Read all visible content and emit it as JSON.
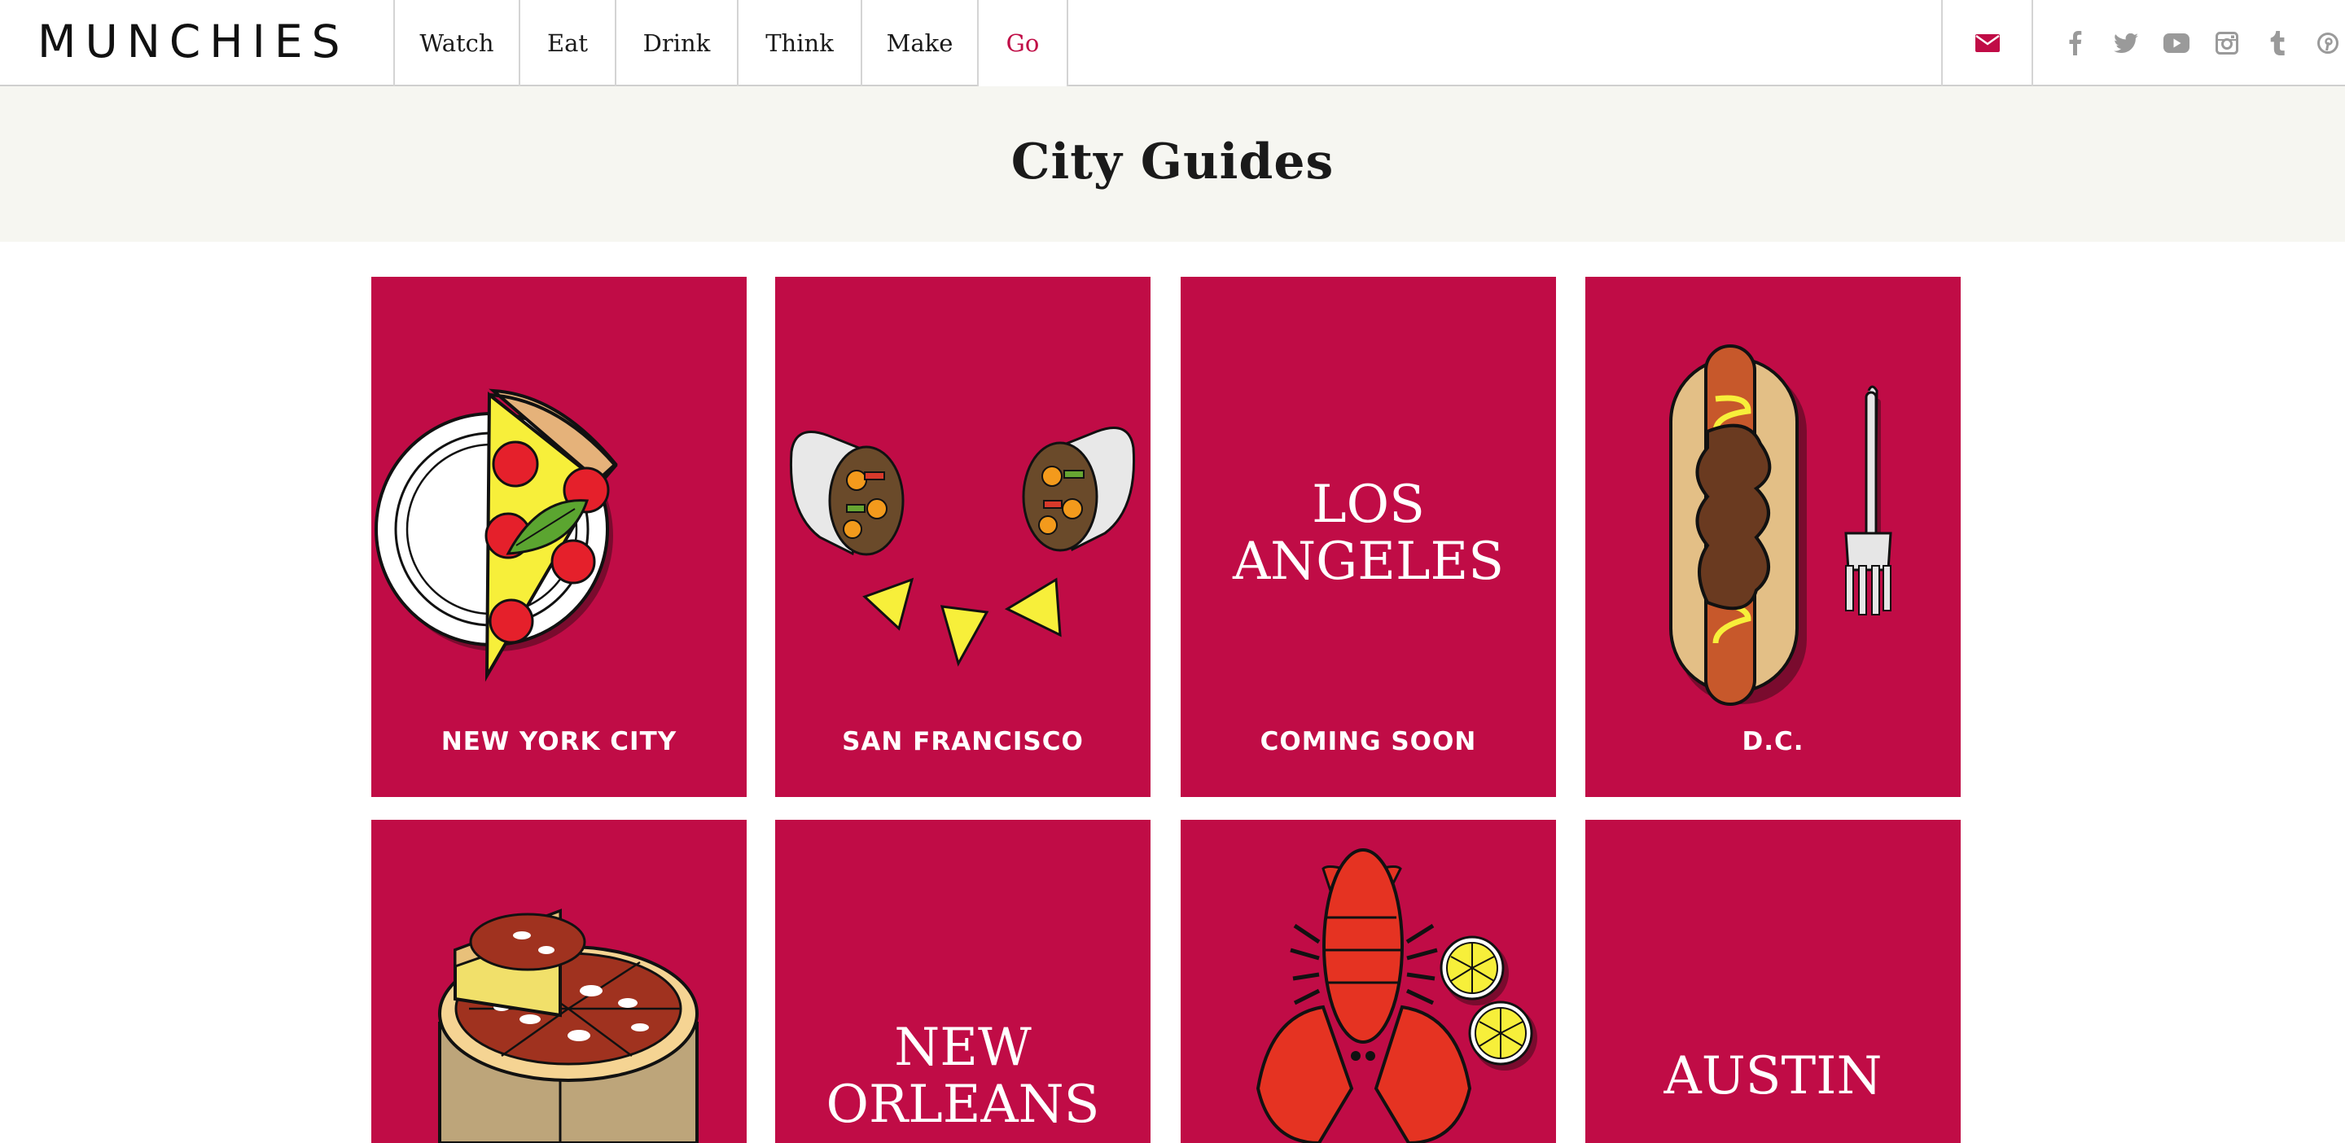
{
  "header": {
    "logo": "MUNCHIES",
    "nav": [
      {
        "label": "Watch",
        "active": false
      },
      {
        "label": "Eat",
        "active": false
      },
      {
        "label": "Drink",
        "active": false
      },
      {
        "label": "Think",
        "active": false
      },
      {
        "label": "Make",
        "active": false
      },
      {
        "label": "Go",
        "active": true
      }
    ],
    "mail_icon": "envelope-icon",
    "socials": [
      "facebook-icon",
      "twitter-icon",
      "youtube-icon",
      "instagram-icon",
      "tumblr-icon",
      "pinterest-icon"
    ]
  },
  "page_title": "City Guides",
  "colors": {
    "brand": "#c00c46",
    "band": "#f6f6f1",
    "nav_text": "#1a1a1a"
  },
  "cards": [
    {
      "label": "NEW YORK CITY",
      "illustration": "pizza-slice-icon"
    },
    {
      "label": "SAN FRANCISCO",
      "illustration": "burrito-icon"
    },
    {
      "big_text_1": "LOS",
      "big_text_2": "ANGELES",
      "label": "COMING SOON"
    },
    {
      "label": "D.C.",
      "illustration": "hot-dog-icon"
    },
    {
      "label": "",
      "illustration": "deep-dish-pizza-icon"
    },
    {
      "big_text_1": "NEW",
      "big_text_2": "ORLEANS"
    },
    {
      "label": "",
      "illustration": "lobster-icon"
    },
    {
      "big_text_1": "AUSTIN"
    }
  ]
}
